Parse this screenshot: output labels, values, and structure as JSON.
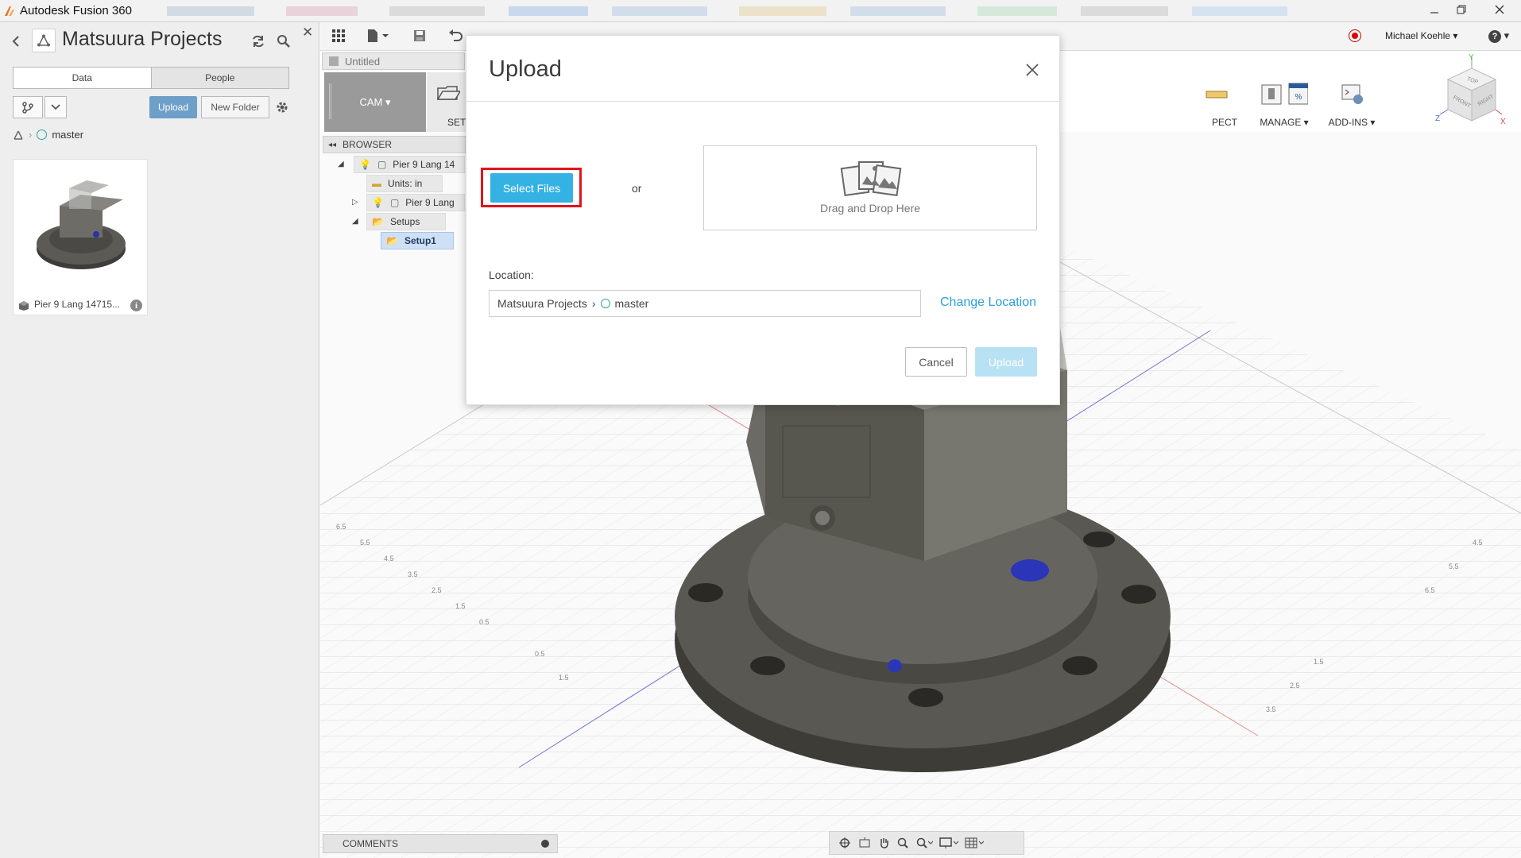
{
  "window": {
    "title": "Autodesk Fusion 360"
  },
  "data_panel": {
    "project_title": "Matsuura Projects",
    "tabs": [
      {
        "label": "Data",
        "active": true
      },
      {
        "label": "People",
        "active": false
      }
    ],
    "upload_label": "Upload",
    "new_folder_label": "New Folder",
    "breadcrumb": {
      "folder": "master"
    },
    "items": [
      {
        "name": "Pier 9 Lang 14715...",
        "info_label": "i"
      }
    ]
  },
  "toolbar": {
    "document_tab": "Untitled",
    "user_name": "Michael Koehle",
    "help_label": "?"
  },
  "ribbon": {
    "workspace_label": "CAM",
    "groups": [
      {
        "label": "SET"
      },
      {
        "label": "PECT"
      },
      {
        "label": "MANAGE"
      },
      {
        "label": "ADD-INS"
      }
    ]
  },
  "browser": {
    "header": "BROWSER",
    "rows": [
      {
        "label": "Pier 9 Lang 14"
      },
      {
        "label": "Units: in"
      },
      {
        "label": "Pier 9 Lang"
      },
      {
        "label": "Setups"
      },
      {
        "label": "Setup1"
      }
    ]
  },
  "viewcube": {
    "faces": [
      "TOP",
      "FRONT",
      "RIGHT"
    ],
    "axes": [
      "Y",
      "Z",
      "X"
    ]
  },
  "comments_label": "COMMENTS",
  "upload_dialog": {
    "title": "Upload",
    "select_files_label": "Select Files",
    "or_label": "or",
    "drop_label": "Drag and Drop Here",
    "location_label": "Location:",
    "location_project": "Matsuura Projects",
    "location_folder": "master",
    "change_location_label": "Change Location",
    "cancel_label": "Cancel",
    "upload_label": "Upload"
  },
  "colors": {
    "accent_blue": "#35b2e4",
    "link_blue": "#2b9fd6",
    "highlight_red": "#e0151a",
    "upload_disabled": "#b8e1f4",
    "folder_ring": "#2aa8a0"
  }
}
